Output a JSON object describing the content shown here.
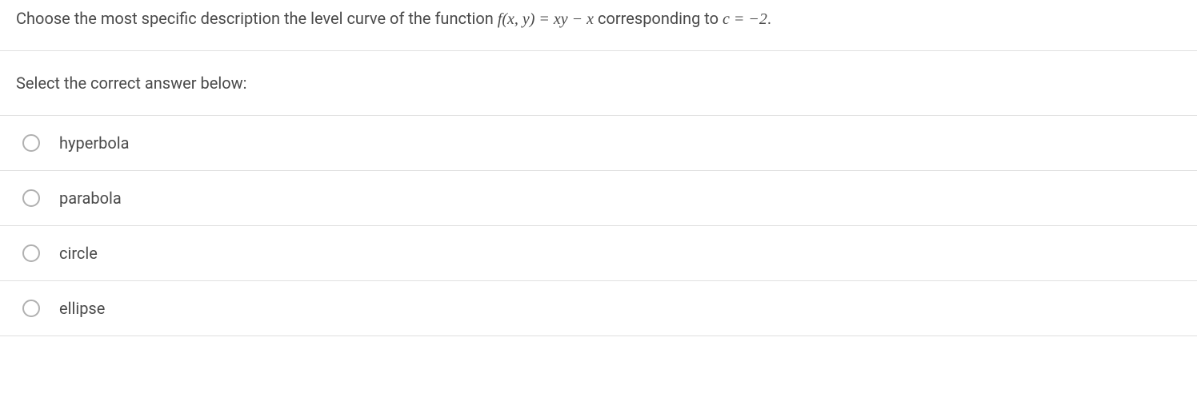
{
  "question": {
    "prefix": "Choose the most specific description the level curve of the function ",
    "func": "f(x, y) = xy − x",
    "middle": " corresponding to ",
    "cval": "c = −2",
    "suffix": "."
  },
  "instruction": "Select the correct answer below:",
  "options": [
    {
      "label": "hyperbola"
    },
    {
      "label": "parabola"
    },
    {
      "label": "circle"
    },
    {
      "label": "ellipse"
    }
  ]
}
